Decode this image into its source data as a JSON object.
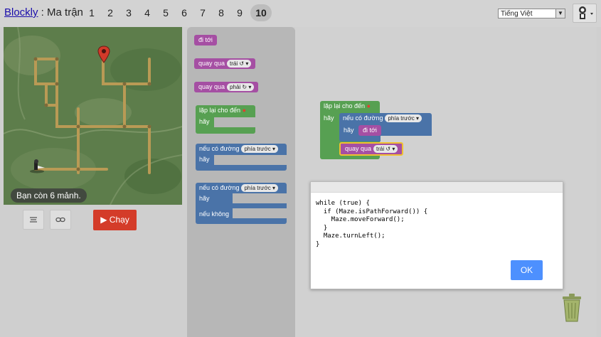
{
  "header": {
    "app_link": "Blockly",
    "separator": " : ",
    "page_title": "Ma trận",
    "levels": [
      "1",
      "2",
      "3",
      "4",
      "5",
      "6",
      "7",
      "8",
      "9"
    ],
    "current_level": "10",
    "language": "Tiếng Việt"
  },
  "maze": {
    "pieces_remaining": "Bạn còn 6 mảnh."
  },
  "controls": {
    "run_label": "Chạy"
  },
  "toolbox": {
    "move_forward": "đi tới",
    "turn_label": "quay qua",
    "left": "trái ↺",
    "right": "phải ↻",
    "repeat_until": "lặp lại cho đến",
    "do": "hãy",
    "if_path": "nếu có đường",
    "ahead": "phía trước",
    "else": "nếu không"
  },
  "workspace": {
    "repeat_until": "lặp lại cho đến",
    "do1": "hãy",
    "if_path": "nếu có đường",
    "ahead": "phía trước",
    "do2": "hãy",
    "move_forward": "đi tới",
    "turn_label": "quay qua",
    "left": "trái ↺"
  },
  "dialog": {
    "code": [
      "while (true) {",
      "  if (Maze.isPathForward()) {",
      "    Maze.moveForward();",
      "  }",
      "  Maze.turnLeft();",
      "}"
    ],
    "ok_label": "OK"
  },
  "colors": {
    "move_block": "#a54fa3",
    "loop_block": "#57a052",
    "logic_block": "#4a73a8",
    "run_button": "#d43c29",
    "ok_button": "#4d90fe"
  }
}
